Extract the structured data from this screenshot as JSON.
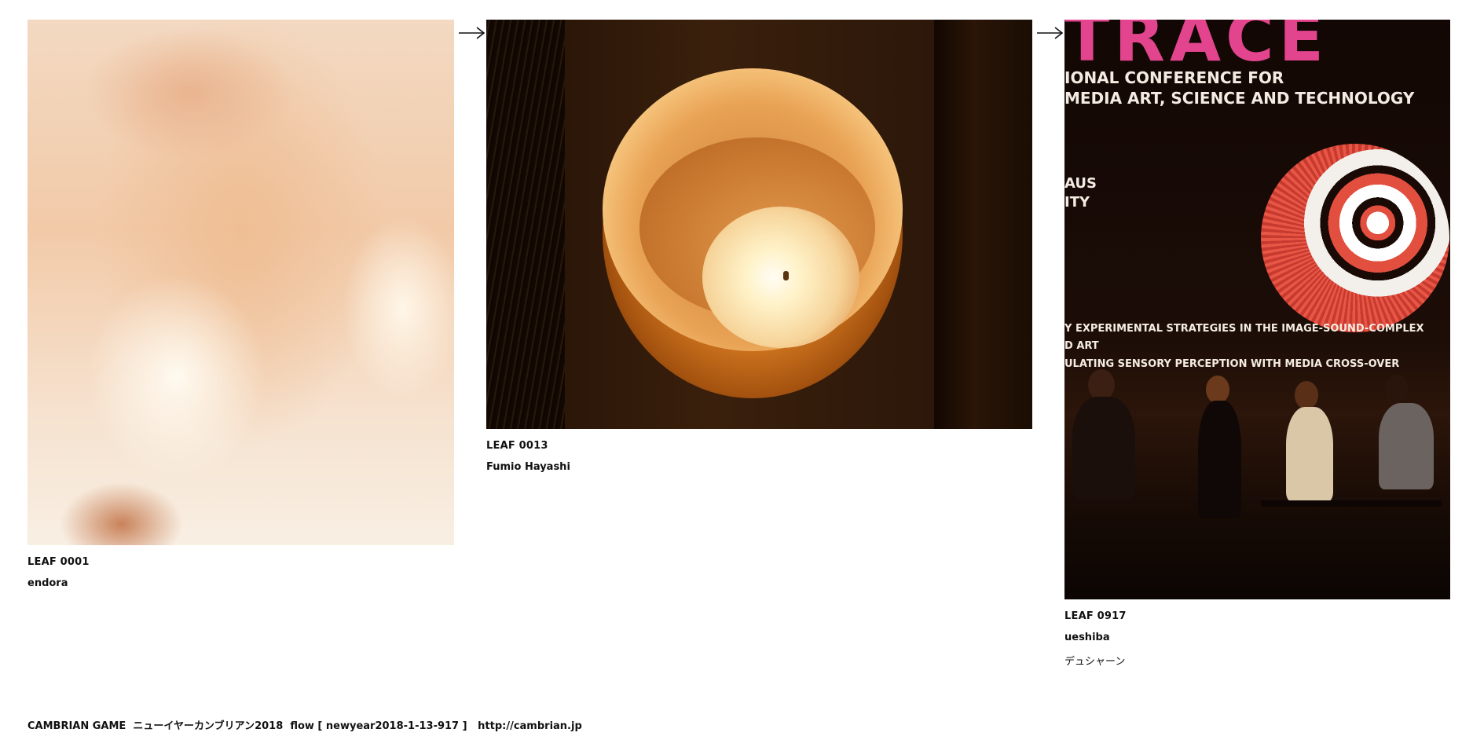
{
  "leaves": [
    {
      "id": "LEAF 0001",
      "author": "endora",
      "note": ""
    },
    {
      "id": "LEAF 0013",
      "author": "Fumio Hayashi",
      "note": ""
    },
    {
      "id": "LEAF 0917",
      "author": "ueshiba",
      "note": "デュシャーン"
    }
  ],
  "photo3_text": {
    "big": "TRACE",
    "line1": "IONAL CONFERENCE FOR",
    "line2": "MEDIA ART, SCIENCE AND TECHNOLOGY",
    "line3": "AUS",
    "line4": "ITY",
    "sub1": "Y EXPERIMENTAL STRATEGIES IN THE IMAGE-SOUND-COMPLEX",
    "sub2": "D ART",
    "sub3": "ULATING SENSORY PERCEPTION WITH MEDIA CROSS-OVER"
  },
  "footer": {
    "game": "CAMBRIAN GAME",
    "event": "ニューイヤーカンブリアン2018",
    "flow": "flow [ newyear2018-1-13-917 ]",
    "link": "http://cambrian.jp"
  },
  "icons": {
    "arrow": "right-arrow-icon"
  }
}
